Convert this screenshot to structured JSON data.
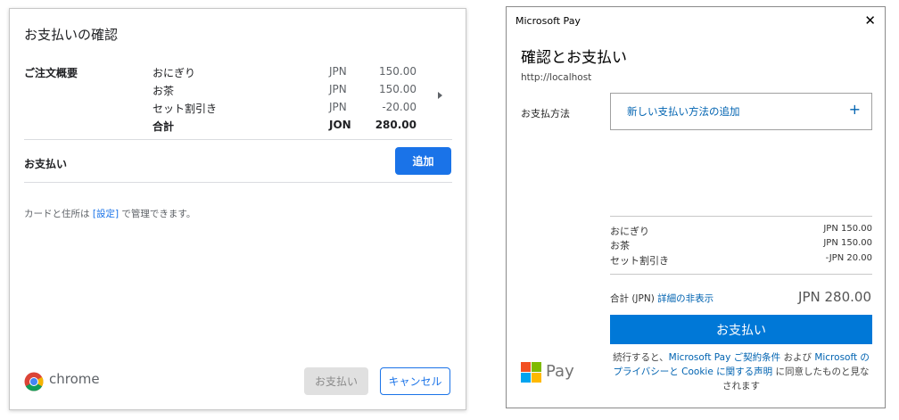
{
  "chrome": {
    "title": "お支払いの確認",
    "summary_label": "ご注文概要",
    "items": [
      {
        "name": "おにぎり",
        "currency": "JPN",
        "amount": "150.00"
      },
      {
        "name": "お茶",
        "currency": "JPN",
        "amount": "150.00"
      },
      {
        "name": "セット割引き",
        "currency": "JPN",
        "amount": "-20.00"
      }
    ],
    "total": {
      "name": "合計",
      "currency": "JON",
      "amount": "280.00"
    },
    "payment_label": "お支払い",
    "add_button": "追加",
    "note_prefix": "カードと住所は",
    "note_link": "[設定]",
    "note_suffix": "で管理できます。",
    "brand": "chrome",
    "pay_button": "お支払い",
    "cancel_button": "キャンセル"
  },
  "mspay": {
    "window_title": "Microsoft Pay",
    "close": "✕",
    "heading": "確認とお支払い",
    "origin": "http://localhost",
    "payment_method_label": "お支払方法",
    "add_payment_method": "新しい支払い方法の追加",
    "add_icon": "+",
    "items": [
      {
        "name": "おにぎり",
        "amount": "JPN 150.00"
      },
      {
        "name": "お茶",
        "amount": "JPN 150.00"
      },
      {
        "name": "セット割引き",
        "amount": "-JPN 20.00"
      }
    ],
    "total_label": "合計 (JPN)",
    "hide_details": "詳細の非表示",
    "total_amount": "JPN 280.00",
    "pay_button": "お支払い",
    "legal_1": "続行すると、",
    "legal_link_1": "Microsoft Pay ご契約条件",
    "legal_2": "および",
    "legal_link_2": "Microsoft のプライバシーと Cookie に関する声明",
    "legal_3": "に同意したものと見なされます",
    "brand": "Pay"
  },
  "colors": {
    "chrome_blue": "#1a73e8",
    "ms_blue": "#0078d7"
  }
}
